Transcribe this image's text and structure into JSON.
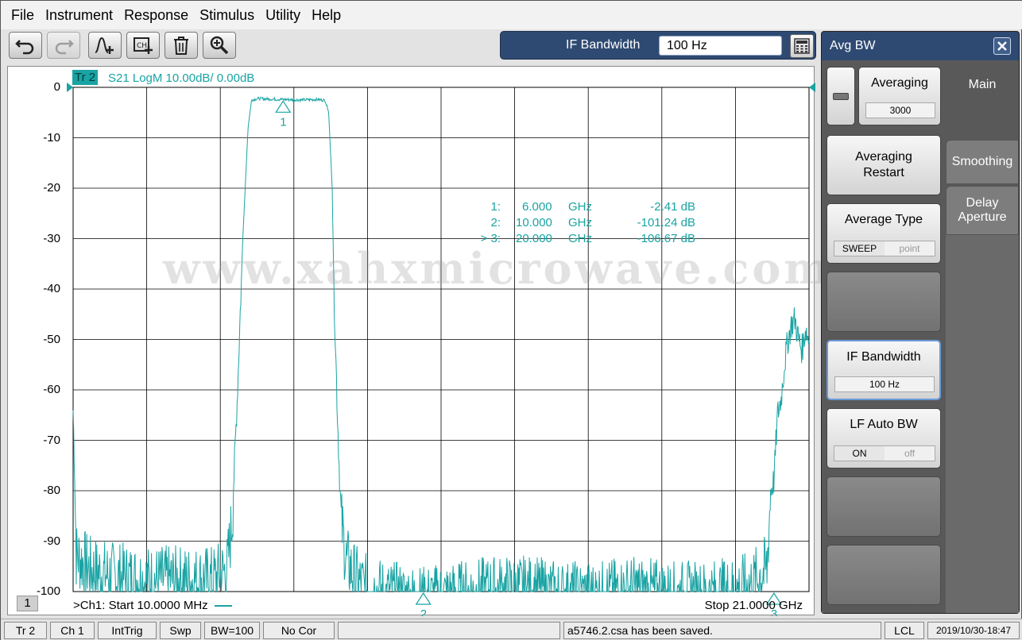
{
  "menu": [
    "File",
    "Instrument",
    "Response",
    "Stimulus",
    "Utility",
    "Help"
  ],
  "ifbw_bar": {
    "label": "IF Bandwidth",
    "value": "100 Hz"
  },
  "trace": {
    "tag": "Tr 2",
    "desc": "S21 LogM 10.00dB/  0.00dB"
  },
  "y_labels": [
    "0",
    "-10",
    "-20",
    "-30",
    "-40",
    "-50",
    "-60",
    "-70",
    "-80",
    "-90",
    "-100"
  ],
  "markers": [
    {
      "prefix": "1:",
      "freq": "6.000",
      "unit": "GHz",
      "value": "-2.41 dB"
    },
    {
      "prefix": "2:",
      "freq": "10.000",
      "unit": "GHz",
      "value": "-101.24 dB"
    },
    {
      "prefix": "> 3:",
      "freq": "20.000",
      "unit": "GHz",
      "value": "-106.67 dB"
    }
  ],
  "marker_labels": [
    "1",
    "2",
    "3"
  ],
  "footer": {
    "left": ">Ch1:  Start   10.0000 MHz",
    "right": "Stop  21.0000 GHz",
    "channel_badge": "1"
  },
  "watermark": "www.xahxmicrowave.com",
  "side_panel": {
    "title": "Avg BW",
    "averaging": {
      "label": "Averaging",
      "value": "3000"
    },
    "averaging_restart": {
      "line1": "Averaging",
      "line2": "Restart"
    },
    "average_type": {
      "label": "Average Type",
      "opt1": "SWEEP",
      "opt2": "point"
    },
    "if_bandwidth": {
      "label": "IF Bandwidth",
      "value": "100 Hz"
    },
    "lf_auto_bw": {
      "label": "LF Auto BW",
      "opt1": "ON",
      "opt2": "off"
    },
    "tabs": {
      "main": "Main",
      "smoothing": "Smoothing",
      "delay_line1": "Delay",
      "delay_line2": "Aperture"
    }
  },
  "status": {
    "tr": "Tr 2",
    "ch": "Ch 1",
    "trig": "IntTrig",
    "swp": "Swp",
    "bw": "BW=100",
    "cor": "No Cor",
    "message": "a5746.2.csa has been saved.",
    "lcl": "LCL",
    "datetime": "2019/10/30-18:47"
  },
  "chart_data": {
    "type": "line",
    "title": "",
    "xlabel": "",
    "ylabel": "",
    "x_start_ghz": 0.01,
    "x_stop_ghz": 21.0,
    "ylim": [
      -100,
      0
    ],
    "grid": true,
    "series": [
      {
        "color": "#1aa3a3",
        "x": [
          0.01,
          0.05,
          0.1,
          0.5,
          1.0,
          2.0,
          3.0,
          4.0,
          4.4,
          4.55,
          4.7,
          4.85,
          5.0,
          5.1,
          5.3,
          5.5,
          6.0,
          6.5,
          7.0,
          7.2,
          7.3,
          7.4,
          7.45,
          7.55,
          7.65,
          7.8,
          8.0,
          8.2,
          8.5,
          9.0,
          10.0,
          11.0,
          12.0,
          13.0,
          14.0,
          15.0,
          16.0,
          17.0,
          18.0,
          19.0,
          19.4,
          19.6,
          19.8,
          19.9,
          20.0,
          20.1,
          20.2,
          20.3,
          20.4,
          20.5,
          20.6,
          20.7,
          20.8,
          20.9,
          21.0
        ],
        "y": [
          -64,
          -75,
          -92,
          -95,
          -96,
          -97,
          -97,
          -97,
          -95,
          -85,
          -60,
          -30,
          -8,
          -2.5,
          -2.2,
          -2.3,
          -2.4,
          -2.5,
          -2.4,
          -2.6,
          -5,
          -20,
          -40,
          -65,
          -85,
          -93,
          -96,
          -98,
          -99,
          -100,
          -101,
          -100,
          -99,
          -99,
          -100,
          -100,
          -99,
          -100,
          -100,
          -99,
          -98,
          -96,
          -95,
          -80,
          -78,
          -65,
          -62,
          -55,
          -50,
          -47,
          -46,
          -50,
          -52,
          -48,
          -50
        ]
      }
    ],
    "markers": [
      {
        "id": 1,
        "x_ghz": 6.0,
        "y_db": -2.41
      },
      {
        "id": 2,
        "x_ghz": 10.0,
        "y_db": -101.24
      },
      {
        "id": 3,
        "x_ghz": 20.0,
        "y_db": -106.67
      }
    ]
  }
}
